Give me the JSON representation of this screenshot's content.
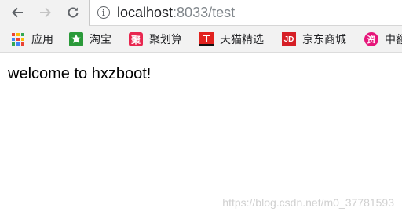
{
  "toolbar": {
    "url_host": "localhost",
    "url_rest": ":8033/test"
  },
  "bookmarks": [
    {
      "label": "应用",
      "icon": "apps-grid-icon"
    },
    {
      "label": "淘宝",
      "icon": "taobao-icon"
    },
    {
      "label": "聚划算",
      "icon": "juhuasuan-icon",
      "glyph": "聚"
    },
    {
      "label": "天猫精选",
      "icon": "tmall-icon",
      "glyph": "T"
    },
    {
      "label": "京东商城",
      "icon": "jd-icon",
      "glyph": "JD"
    },
    {
      "label": "中额",
      "icon": "partial-bookmark-icon",
      "glyph": "资"
    }
  ],
  "page": {
    "body_text": "welcome to hxzboot!",
    "watermark": "https://blog.csdn.net/m0_37781593"
  },
  "colors": {
    "apps_dots": [
      "#ea4335",
      "#fbbc05",
      "#34a853",
      "#4285f4",
      "#ea4335",
      "#fbbc05",
      "#34a853",
      "#4285f4",
      "#ea4335"
    ],
    "taobao": "#2b9a3a",
    "juhuasuan": "#e8264f",
    "tmall": "#e1221e",
    "jd": "#d61f26",
    "partial": "#e6167a"
  }
}
